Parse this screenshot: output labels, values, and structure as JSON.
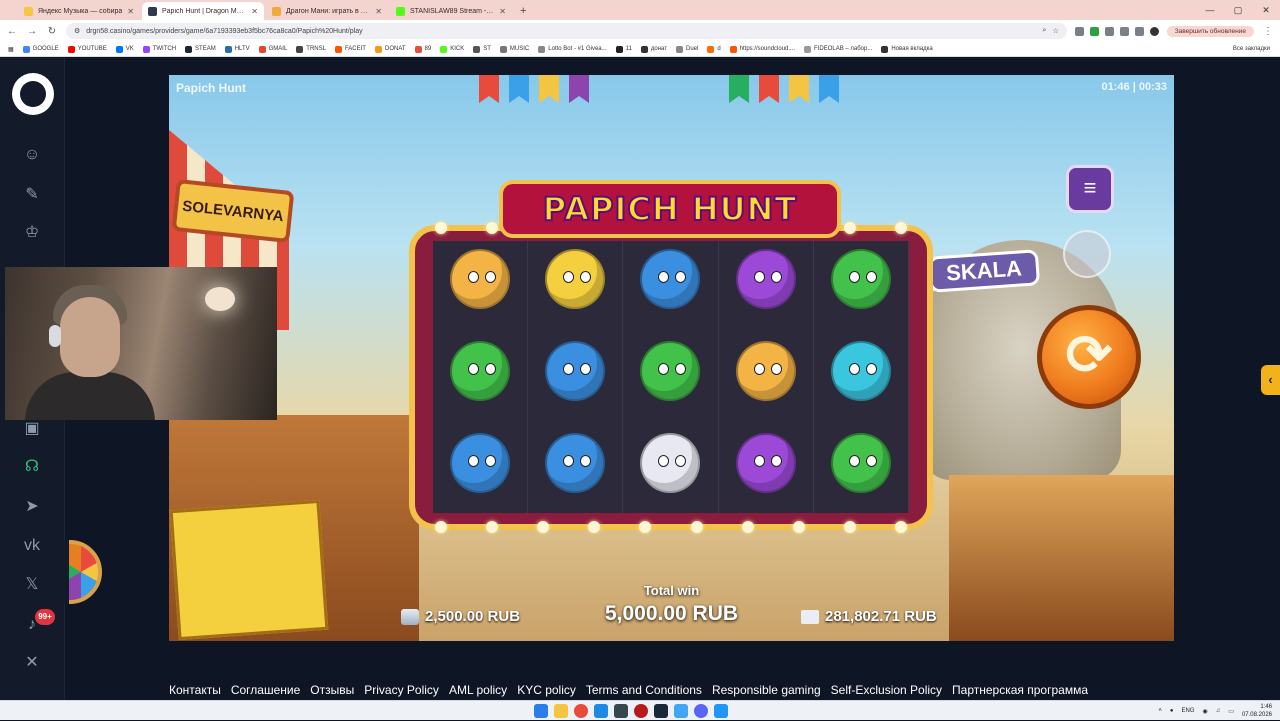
{
  "browser": {
    "tabs": [
      {
        "title": "Яндекс Музыка — собирa",
        "color": "#f6c744",
        "active": false
      },
      {
        "title": "Papich Hunt | Dragon Mone",
        "color": "#2e3a52",
        "active": true
      },
      {
        "title": "Драгон Мани: играть в онлайн",
        "color": "#f2a93b",
        "active": false
      },
      {
        "title": "STANISLAW89 Stream - Watch",
        "color": "#53fc18",
        "active": false
      }
    ],
    "new_tab": "+",
    "url": "drgn58.casino/games/providers/game/6a7193393eb3f5bc76ca8ca0/Papich%20Hunt/play",
    "update_button": "Завершить обновление",
    "bookmarks": [
      {
        "label": "GOOGLE",
        "color": "#4285f4"
      },
      {
        "label": "YOUTUBE",
        "color": "#ff0000"
      },
      {
        "label": "VK",
        "color": "#0077ff"
      },
      {
        "label": "TWITCH",
        "color": "#9146ff"
      },
      {
        "label": "STEAM",
        "color": "#1b2838"
      },
      {
        "label": "HLTV",
        "color": "#2d6da3"
      },
      {
        "label": "GMAIL",
        "color": "#ea4335"
      },
      {
        "label": "TRNSL",
        "color": "#444444"
      },
      {
        "label": "FACEIT",
        "color": "#ff5500"
      },
      {
        "label": "DONAT",
        "color": "#f39c12"
      },
      {
        "label": "89",
        "color": "#e74c3c"
      },
      {
        "label": "KICK",
        "color": "#53fc18"
      },
      {
        "label": "ST",
        "color": "#555555"
      },
      {
        "label": "MUSIC",
        "color": "#777777"
      },
      {
        "label": "Lotto Bot - #1 Givea...",
        "color": "#888888"
      },
      {
        "label": "11",
        "color": "#222222"
      },
      {
        "label": "донат",
        "color": "#333333"
      },
      {
        "label": "Duel",
        "color": "#888888"
      },
      {
        "label": "d",
        "color": "#ff6a00"
      },
      {
        "label": "https://soundcloud....",
        "color": "#ff5500"
      },
      {
        "label": "FIDEOLAB – лабор...",
        "color": "#999999"
      },
      {
        "label": "Новая вкладка",
        "color": "#333333"
      }
    ],
    "all_bookmarks": "Все закладки"
  },
  "sidebar": {
    "icons": [
      "smile-icon",
      "ticket-icon",
      "trophy-icon",
      "bag-icon",
      "headset-icon",
      "telegram-icon",
      "vk-icon",
      "x-icon",
      "bell-icon",
      "mute-icon"
    ],
    "notification_count": "99+"
  },
  "game": {
    "title": "Papich Hunt",
    "timer": "01:46 | 00:33",
    "logo": "PAPICH HUNT",
    "left_sign": "SOLEVARNYA",
    "right_sign": "SKALA",
    "menu_icon": "≡",
    "spin_icon": "⟳",
    "bet": "2,500.00 RUB",
    "total_win_label": "Total win",
    "total_win": "5,000.00 RUB",
    "balance": "281,802.71 RUB",
    "reels": [
      [
        "#f4b445",
        "#43c24b",
        "#3b8fe0"
      ],
      [
        "#f4d03f",
        "#3b8fe0",
        "#3b8fe0"
      ],
      [
        "#3b8fe0",
        "#43c24b",
        "#e8e8f2"
      ],
      [
        "#9b49d6",
        "#f4b445",
        "#9b49d6"
      ],
      [
        "#43c24b",
        "#3bc6e0",
        "#43c24b"
      ]
    ]
  },
  "side_handle": "‹",
  "footer_links": [
    "Контакты",
    "Соглашение",
    "Отзывы",
    "Privacy Policy",
    "AML policy",
    "KYC policy",
    "Terms and Conditions",
    "Responsible gaming",
    "Self-Exclusion Policy",
    "Партнерская программа"
  ],
  "taskbar": {
    "lang": "ENG",
    "time": "1:46",
    "date": "07.08.2026"
  }
}
